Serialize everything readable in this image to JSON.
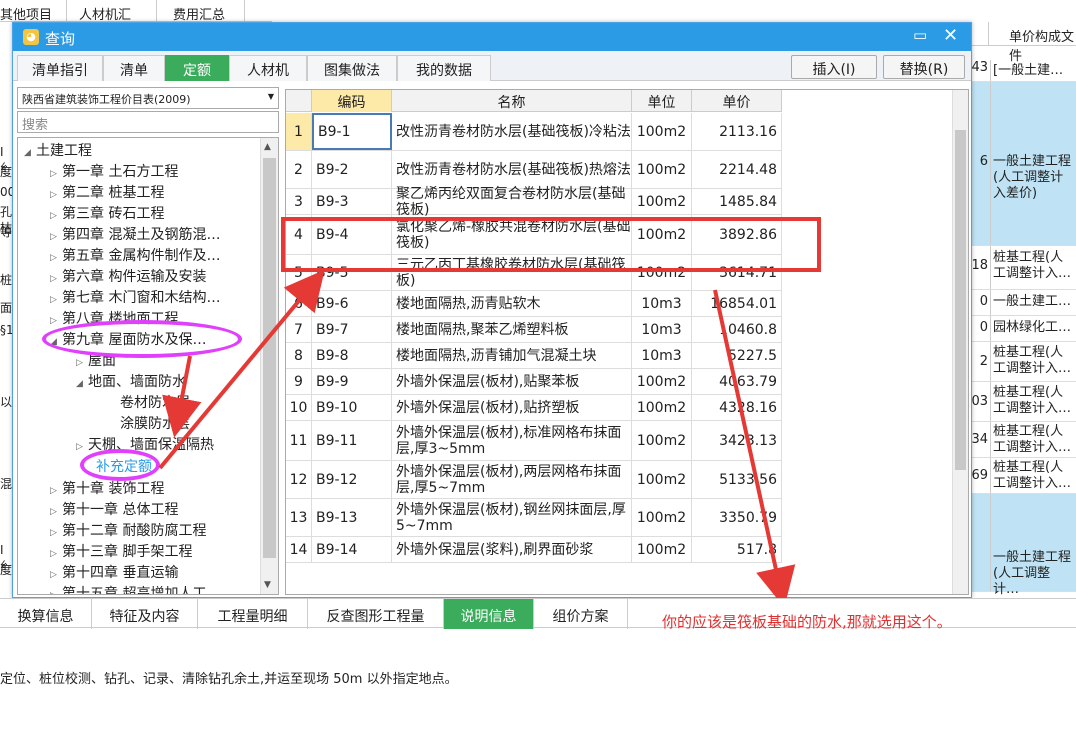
{
  "bg_tabs": [
    "其他项目",
    "人材机汇总",
    "费用汇总"
  ],
  "right_panel": {
    "header_num": "",
    "header_title": "单价构成文件",
    "row0_num": "43",
    "rows": [
      {
        "num": "43",
        "text": "[一般土建…"
      },
      {
        "num": "6",
        "text": "一般土建工程(人工调整计入差价)"
      },
      {
        "num": "18",
        "text": "桩基工程(人工调整计入…"
      },
      {
        "num": "0",
        "text": "一般土建工…"
      },
      {
        "num": "0",
        "text": "园林绿化工…"
      },
      {
        "num": "2",
        "text": "桩基工程(人工调整计入…"
      },
      {
        "num": "03",
        "text": "桩基工程(人工调整计入…"
      },
      {
        "num": "34",
        "text": "桩基工程(人工调整计入…"
      },
      {
        "num": "69",
        "text": "桩基工程(人工调整计入…"
      },
      {
        "num": "",
        "text": "一般土建工程(人工调整计…"
      }
    ]
  },
  "left_strip": [
    "I 纟",
    "度",
    "00r",
    "孔枯",
    "等",
    "桩",
    "面",
    "§1",
    "以",
    "混",
    "I 纟",
    "度"
  ],
  "dialog": {
    "title": "查询",
    "max_icon": "▭",
    "close_icon": "✕",
    "tabs": [
      "清单指引",
      "清单",
      "定额",
      "人材机",
      "图集做法",
      "我的数据"
    ],
    "active_tab": "定额",
    "insert_label": "插入(I)",
    "replace_label": "替换(R)",
    "library": "陕西省建筑装饰工程价目表(2009)",
    "search_placeholder": "搜索",
    "tree": [
      {
        "label": "土建工程",
        "level": 0,
        "tri": "◢"
      },
      {
        "label": "第一章  土石方工程",
        "level": 1,
        "tri": "▷"
      },
      {
        "label": "第二章  桩基工程",
        "level": 1,
        "tri": "▷"
      },
      {
        "label": "第三章  砖石工程",
        "level": 1,
        "tri": "▷"
      },
      {
        "label": "第四章  混凝土及钢筋混…",
        "level": 1,
        "tri": "▷"
      },
      {
        "label": "第五章  金属构件制作及…",
        "level": 1,
        "tri": "▷"
      },
      {
        "label": "第六章  构件运输及安装",
        "level": 1,
        "tri": "▷"
      },
      {
        "label": "第七章  木门窗和木结构…",
        "level": 1,
        "tri": "▷"
      },
      {
        "label": "第八章  楼地面工程",
        "level": 1,
        "tri": "▷"
      },
      {
        "label": "第九章  屋面防水及保…",
        "level": 1,
        "tri": "◢"
      },
      {
        "label": "屋面",
        "level": 2,
        "tri": "▷"
      },
      {
        "label": "地面、墙面防水",
        "level": 2,
        "tri": "◢"
      },
      {
        "label": "卷材防水层",
        "level": 3,
        "tri": ""
      },
      {
        "label": "涂膜防水层",
        "level": 3,
        "tri": ""
      },
      {
        "label": "天棚、墙面保温隔热",
        "level": 2,
        "tri": "▷"
      },
      {
        "label": "补充定额",
        "level": 2,
        "tri": ""
      },
      {
        "label": "第十章  装饰工程",
        "level": 1,
        "tri": "▷"
      },
      {
        "label": "第十一章  总体工程",
        "level": 1,
        "tri": "▷"
      },
      {
        "label": "第十二章  耐酸防腐工程",
        "level": 1,
        "tri": "▷"
      },
      {
        "label": "第十三章  脚手架工程",
        "level": 1,
        "tri": "▷"
      },
      {
        "label": "第十四章  垂直运输",
        "level": 1,
        "tri": "▷"
      },
      {
        "label": "第十五章  超高增加人工…",
        "level": 1,
        "tri": "▷"
      }
    ],
    "grid": {
      "headers": [
        "",
        "编码",
        "名称",
        "单位",
        "单价"
      ],
      "rows": [
        {
          "n": "1",
          "code": "B9-1",
          "name": "改性沥青卷材防水层(基础筏板)冷粘法",
          "unit": "100m2",
          "price": "2113.16"
        },
        {
          "n": "2",
          "code": "B9-2",
          "name": "改性沥青卷材防水层(基础筏板)热熔法",
          "unit": "100m2",
          "price": "2214.48"
        },
        {
          "n": "3",
          "code": "B9-3",
          "name": "聚乙烯丙纶双面复合卷材防水层(基础筏板)",
          "unit": "100m2",
          "price": "1485.84"
        },
        {
          "n": "4",
          "code": "B9-4",
          "name": "氯化聚乙烯-橡胶共混卷材防水层(基础筏板)",
          "unit": "100m2",
          "price": "3892.86"
        },
        {
          "n": "5",
          "code": "B9-5",
          "name": "三元乙丙丁基橡胶卷材防水层(基础筏板)",
          "unit": "100m2",
          "price": "3614.71"
        },
        {
          "n": "6",
          "code": "B9-6",
          "name": "楼地面隔热,沥青贴软木",
          "unit": "10m3",
          "price": "16854.01"
        },
        {
          "n": "7",
          "code": "B9-7",
          "name": "楼地面隔热,聚苯乙烯塑料板",
          "unit": "10m3",
          "price": "10460.8"
        },
        {
          "n": "8",
          "code": "B9-8",
          "name": "楼地面隔热,沥青铺加气混凝土块",
          "unit": "10m3",
          "price": "5227.5"
        },
        {
          "n": "9",
          "code": "B9-9",
          "name": "外墙外保温层(板材),贴聚苯板",
          "unit": "100m2",
          "price": "4063.79"
        },
        {
          "n": "10",
          "code": "B9-10",
          "name": "外墙外保温层(板材),贴挤塑板",
          "unit": "100m2",
          "price": "4328.16"
        },
        {
          "n": "11",
          "code": "B9-11",
          "name": "外墙外保温层(板材),标准网格布抹面层,厚3~5mm",
          "unit": "100m2",
          "price": "3423.13"
        },
        {
          "n": "12",
          "code": "B9-12",
          "name": "外墙外保温层(板材),两层网格布抹面层,厚5~7mm",
          "unit": "100m2",
          "price": "5133.56"
        },
        {
          "n": "13",
          "code": "B9-13",
          "name": "外墙外保温层(板材),钢丝网抹面层,厚5~7mm",
          "unit": "100m2",
          "price": "3350.79"
        },
        {
          "n": "14",
          "code": "B9-14",
          "name": "外墙外保温层(浆料),刷界面砂浆",
          "unit": "100m2",
          "price": "517.8"
        }
      ]
    }
  },
  "bottom_tabs": [
    "换算信息",
    "特征及内容",
    "工程量明细",
    "反查图形工程量",
    "说明信息",
    "组价方案"
  ],
  "bottom_active": "说明信息",
  "description": "定位、桩位校测、钻孔、记录、清除钻孔余土,并运至现场 50m 以外指定地点。",
  "annotation": "你的应该是筏板基础的防水,那就选用这个。",
  "colors": {
    "accent": "#2b9be6",
    "active_tab": "#3aac5b",
    "annotation": "#e53935",
    "highlight": "#e040fb"
  }
}
